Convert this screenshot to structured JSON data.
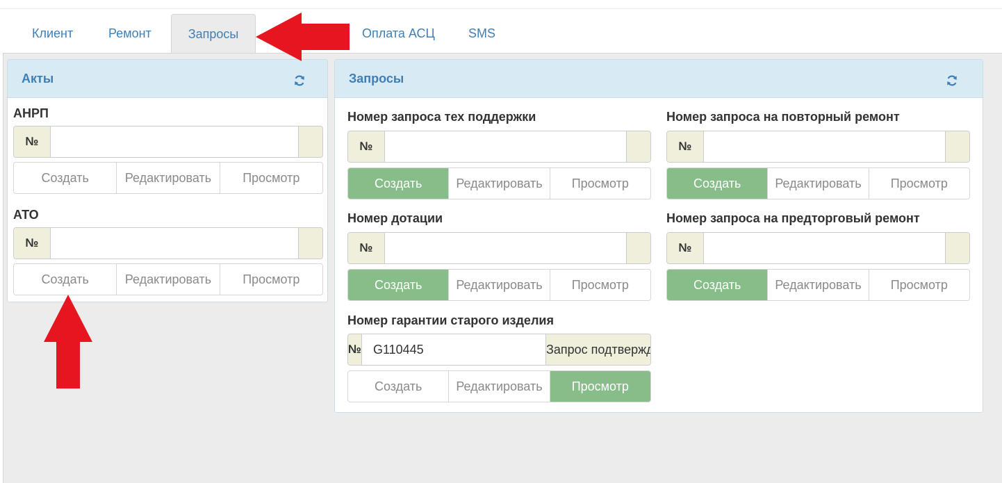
{
  "tabs": [
    {
      "label": "Клиент"
    },
    {
      "label": "Ремонт"
    },
    {
      "label": "Запросы"
    },
    {
      "label": "Оплата АСЦ"
    },
    {
      "label": "SMS"
    }
  ],
  "acts_panel": {
    "title": "Акты",
    "groups": [
      {
        "label": "АНРП",
        "prefix": "№",
        "value": "",
        "buttons": [
          "Создать",
          "Редактировать",
          "Просмотр"
        ]
      },
      {
        "label": "АТО",
        "prefix": "№",
        "value": "",
        "buttons": [
          "Создать",
          "Редактировать",
          "Просмотр"
        ]
      }
    ]
  },
  "requests_panel": {
    "title": "Запросы",
    "groups": [
      {
        "label": "Номер запроса тех поддержки",
        "prefix": "№",
        "value": "",
        "buttons": [
          "Создать",
          "Редактировать",
          "Просмотр"
        ]
      },
      {
        "label": "Номер запроса на повторный ремонт",
        "prefix": "№",
        "value": "",
        "buttons": [
          "Создать",
          "Редактировать",
          "Просмотр"
        ]
      },
      {
        "label": "Номер дотации",
        "prefix": "№",
        "value": "",
        "buttons": [
          "Создать",
          "Редактировать",
          "Просмотр"
        ]
      },
      {
        "label": "Номер запроса на предторговый ремонт",
        "prefix": "№",
        "value": "",
        "buttons": [
          "Создать",
          "Редактировать",
          "Просмотр"
        ]
      },
      {
        "label": "Номер гарантии старого изделия",
        "prefix": "№",
        "value": "G110445",
        "status": "Запрос подтвержден",
        "buttons": [
          "Создать",
          "Редактировать",
          "Просмотр"
        ]
      }
    ]
  },
  "colors": {
    "accent_text": "#3f7fb5",
    "panel_header": "#d8eaf4",
    "button_active": "#86bd88",
    "addon_bg": "#efefdc",
    "annotation_arrow": "#e5161f"
  },
  "icons": {
    "refresh": "refresh-icon",
    "arrow_left": "red-arrow-left-icon",
    "arrow_up": "red-arrow-up-icon"
  }
}
